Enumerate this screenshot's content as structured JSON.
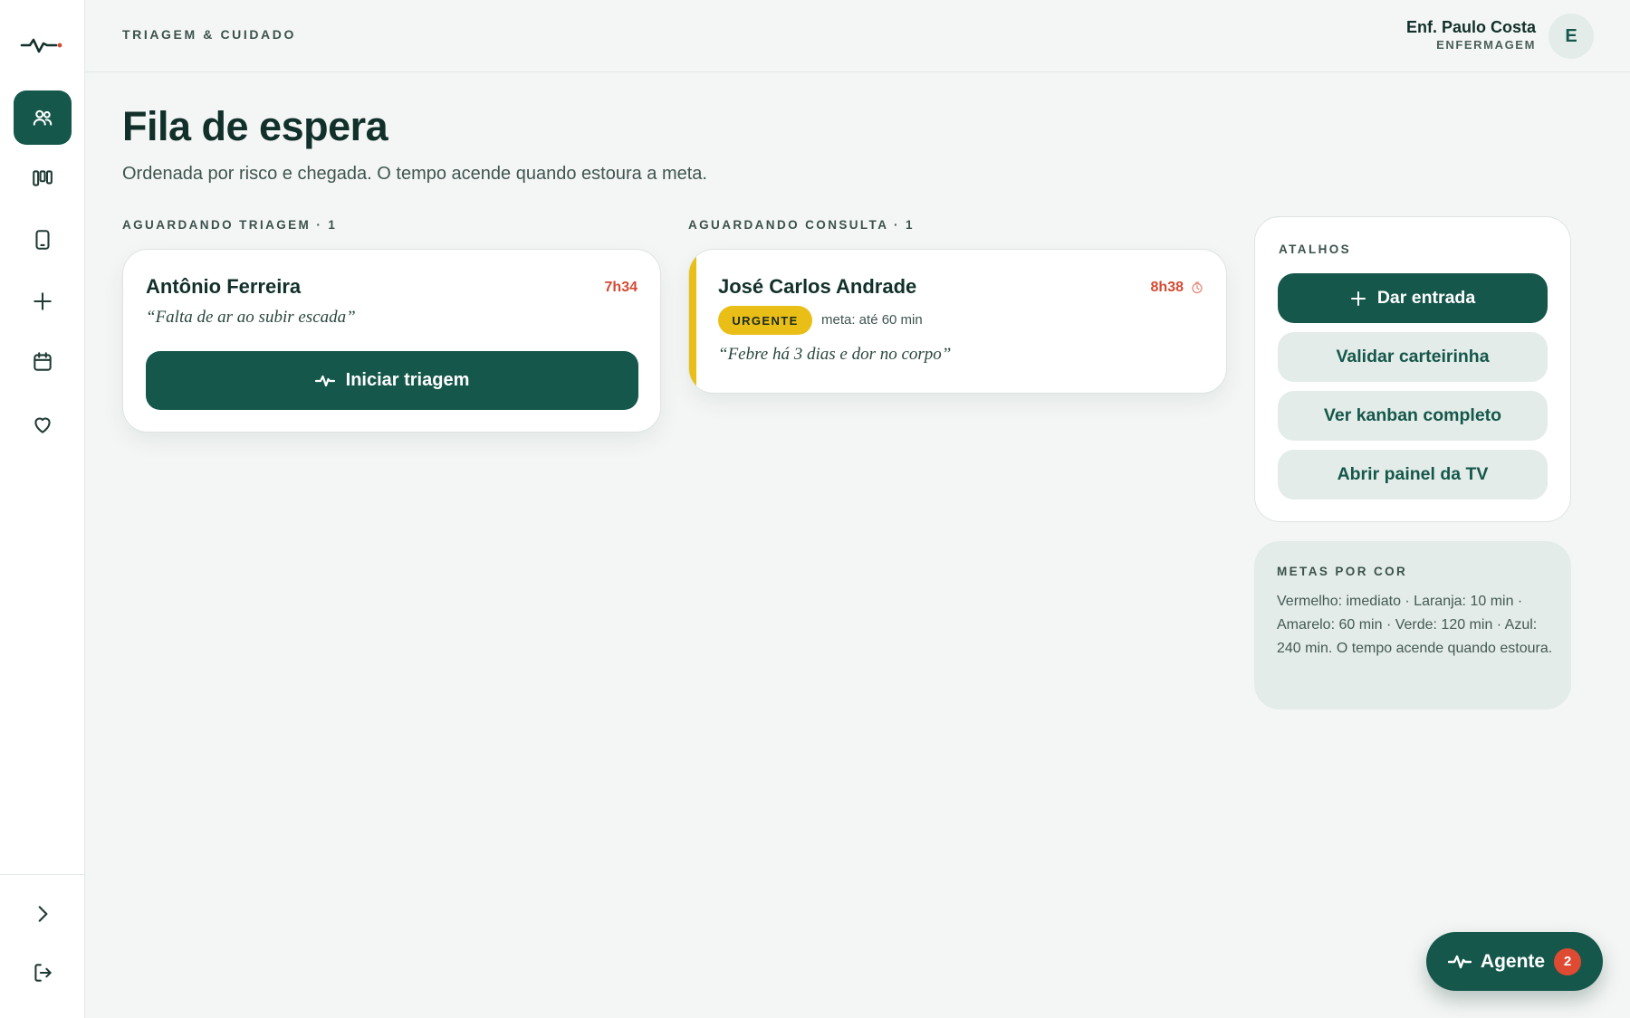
{
  "sidebar": {
    "items": [
      {
        "name": "patients",
        "icon": "users-icon",
        "active": true
      },
      {
        "name": "kanban",
        "icon": "kanban-icon",
        "active": false
      },
      {
        "name": "device",
        "icon": "tablet-icon",
        "active": false
      },
      {
        "name": "add",
        "icon": "plus-icon",
        "active": false
      },
      {
        "name": "calendar",
        "icon": "calendar-icon",
        "active": false
      },
      {
        "name": "favorites",
        "icon": "heart-icon",
        "active": false
      }
    ],
    "bottom": [
      {
        "name": "expand",
        "icon": "chevron-right-icon"
      },
      {
        "name": "logout",
        "icon": "logout-icon"
      }
    ]
  },
  "header": {
    "title": "TRIAGEM & CUIDADO",
    "user_name": "Enf. Paulo Costa",
    "user_role": "ENFERMAGEM",
    "avatar_initial": "E"
  },
  "main": {
    "title": "Fila de espera",
    "subtitle": "Ordenada por risco e chegada. O tempo acende quando estoura a meta.",
    "columns": [
      {
        "label": "AGUARDANDO TRIAGEM · 1",
        "cards": [
          {
            "patient": "Antônio Ferreira",
            "wait": "7h34",
            "complaint": "“Falta de ar ao subir escada”",
            "action_label": "Iniciar triagem"
          }
        ]
      },
      {
        "label": "AGUARDANDO CONSULTA · 1",
        "cards": [
          {
            "patient": "José Carlos Andrade",
            "wait": "8h38",
            "priority": "URGENTE",
            "priority_color": "#e9bf17",
            "goal": "meta: até 60 min",
            "complaint": "“Febre há 3 dias e dor no corpo”"
          }
        ]
      }
    ]
  },
  "shortcuts": {
    "label": "ATALHOS",
    "items": [
      {
        "label": "Dar entrada",
        "style": "primary"
      },
      {
        "label": "Validar carteirinha",
        "style": "soft"
      },
      {
        "label": "Ver kanban completo",
        "style": "soft"
      },
      {
        "label": "Abrir painel da TV",
        "style": "soft"
      }
    ]
  },
  "goals": {
    "label": "METAS POR COR",
    "text": "Vermelho: imediato · Laranja: 10 min · Amarelo: 60 min · Verde: 120 min · Azul: 240 min. O tempo acende quando estoura."
  },
  "agent": {
    "label": "Agente",
    "count": "2"
  },
  "colors": {
    "brand": "#15574b",
    "alert": "#d44b32",
    "urgent": "#e9bf17",
    "background": "#f4f6f5"
  }
}
